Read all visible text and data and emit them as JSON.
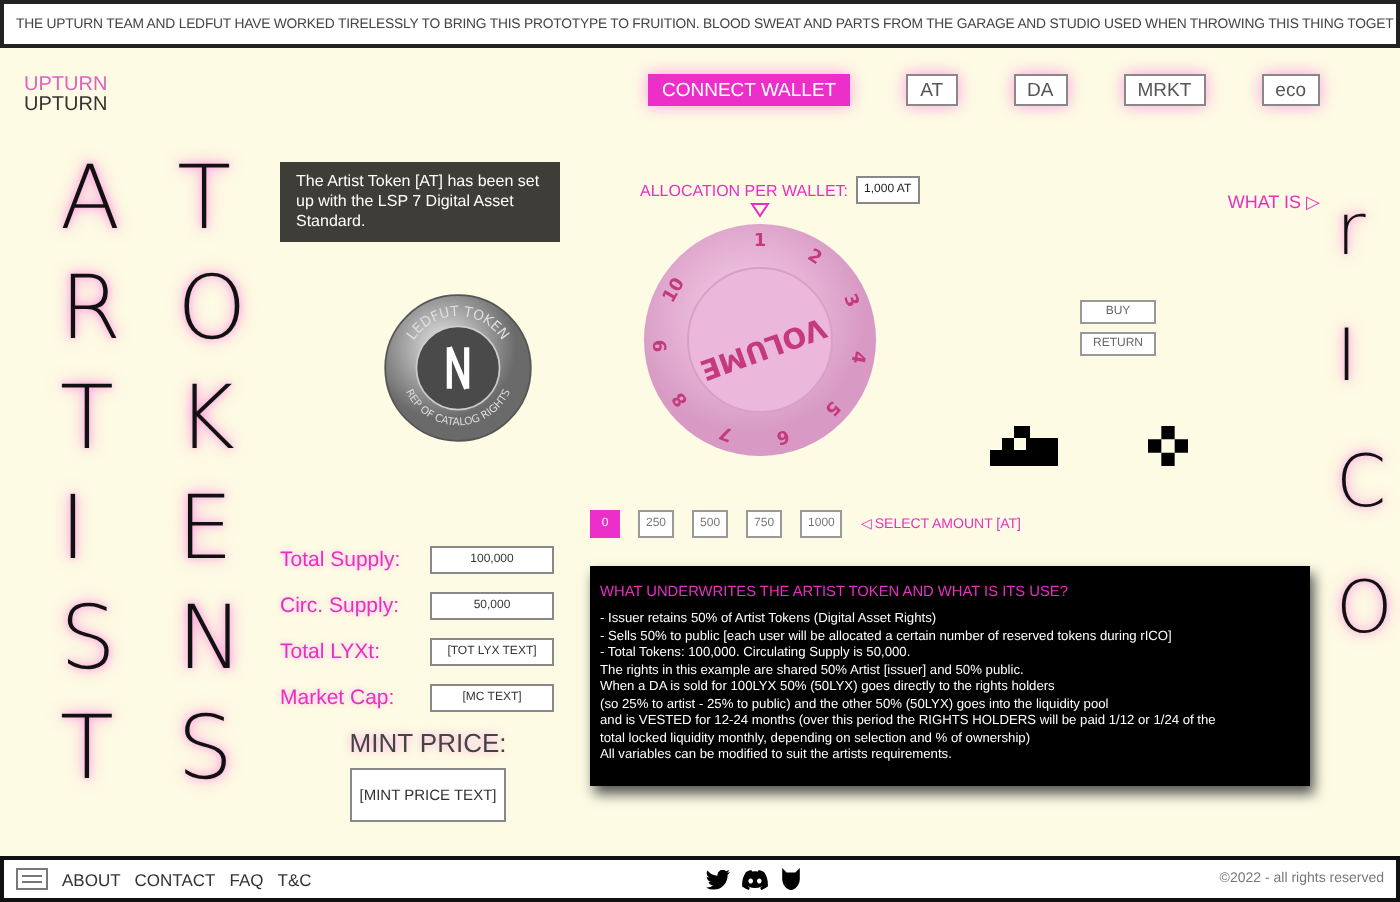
{
  "banner": {
    "text": "THE UPTURN TEAM AND LEDFUT HAVE WORKED TIRELESSLY TO BRING THIS PROTOTYPE TO FRUITION. BLOOD SWEAT AND PARTS FROM THE GARAGE AND STUDIO USED WHEN THROWING THIS THING TOGET"
  },
  "logo": {
    "text": "UPTURN",
    "mirrored": "UPTURN"
  },
  "nav": [
    {
      "label": "CONNECT WALLET",
      "selected": true
    },
    {
      "label": "AT",
      "selected": false
    },
    {
      "label": "DA",
      "selected": false
    },
    {
      "label": "MRKT",
      "selected": false
    },
    {
      "label": "eco",
      "selected": false
    }
  ],
  "title_columns": [
    [
      "A",
      "R",
      "T",
      "I",
      "S",
      "T"
    ],
    [
      "T",
      "O",
      "K",
      "E",
      "N",
      "S"
    ]
  ],
  "side_title": [
    "r",
    "I",
    "C",
    "O"
  ],
  "info_box": {
    "text": "The Artist Token [AT] has been set up with the LSP 7 Digital Asset Standard."
  },
  "coin": {
    "top_text": "LEDFUT TOKEN",
    "bottom_text": "REP OF CATALOG RIGHTS"
  },
  "stats": [
    {
      "label": "Total Supply:",
      "value": "100,000"
    },
    {
      "label": "Circ. Supply:",
      "value": "50,000"
    },
    {
      "label": "Total LYXt:",
      "value": "[TOT LYX TEXT]"
    },
    {
      "label": "Market Cap:",
      "value": "[MC TEXT]"
    }
  ],
  "mint": {
    "title": "MINT PRICE:",
    "value": "[MINT PRICE TEXT]"
  },
  "allocation": {
    "label": "ALLOCATION PER WALLET:",
    "value": "1,000 AT"
  },
  "what_is": {
    "label": "WHAT IS ▷"
  },
  "dial": {
    "label": "VOLUME",
    "numbers": [
      "1",
      "2",
      "3",
      "4",
      "5",
      "6",
      "7",
      "8",
      "9",
      "10"
    ]
  },
  "actions": [
    "BUY",
    "RETURN"
  ],
  "amounts": [
    {
      "label": "0",
      "selected": true
    },
    {
      "label": "250",
      "selected": false
    },
    {
      "label": "500",
      "selected": false
    },
    {
      "label": "750",
      "selected": false
    },
    {
      "label": "1000",
      "selected": false
    }
  ],
  "amount_hint": "◁ SELECT AMOUNT [AT]",
  "explainer": {
    "title": "WHAT UNDERWRITES THE ARTIST TOKEN AND WHAT IS ITS USE?",
    "lines": [
      "- Issuer retains 50% of Artist Tokens (Digital Asset Rights)",
      "- Sells 50% to public [each user will be allocated a certain number of reserved tokens during rICO]",
      "- Total Tokens: 100,000. Circulating Supply is 50,000.",
      "The rights in this example are shared 50% Artist [issuer] and 50% public.",
      "When a DA is sold for 100LYX 50% (50LYX) goes directly to the rights holders",
      "(so 25% to artist - 25% to public) and the other 50% (50LYX) goes into the liquidity pool",
      "and is VESTED for 12-24 months (over this period the RIGHTS HOLDERS will be paid 1/12 or 1/24 of the",
      "total locked liquidity monthly, depending on selection and % of ownership)",
      "All variables can be modified to suit the artists requirements."
    ]
  },
  "footer": {
    "links": [
      "ABOUT",
      "CONTACT",
      "FAQ",
      "T&C"
    ],
    "copyright": "©2022 - all rights reserved"
  }
}
